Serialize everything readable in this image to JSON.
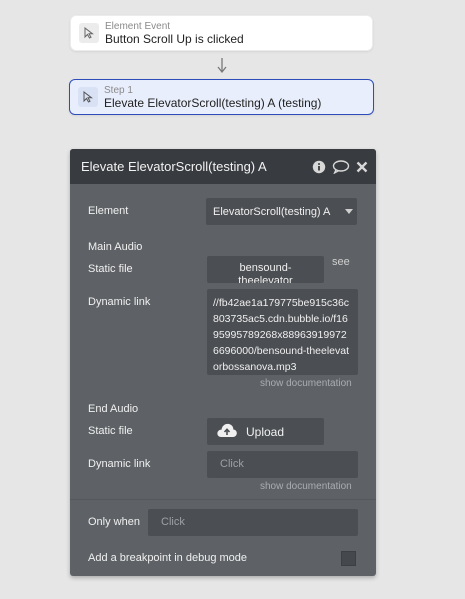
{
  "event_card": {
    "kind": "Element Event",
    "title": "Button Scroll Up is clicked",
    "icon": "pointer-icon"
  },
  "step_card": {
    "kind": "Step 1",
    "title": "Elevate ElevatorScroll(testing) A (testing)",
    "icon": "pointer-icon"
  },
  "panel": {
    "title": "Elevate ElevatorScroll(testing) A",
    "icons": [
      "info-icon",
      "comment-icon",
      "close-icon"
    ],
    "element_label": "Element",
    "element_value": "ElevatorScroll(testing) A",
    "main_audio": {
      "heading": "Main Audio",
      "static_label": "Static file",
      "static_value": "bensound-",
      "static_value_cut": "theelevator",
      "see": "see",
      "dynamic_label": "Dynamic link",
      "dynamic_value": "//fb42ae1a179775be915c36c803735ac5.cdn.bubble.io/f1695995789268x889639199726696000/bensound-theelevatorbossanova.mp3",
      "show_doc": "show documentation"
    },
    "end_audio": {
      "heading": "End Audio",
      "static_label": "Static file",
      "upload_label": "Upload",
      "dynamic_label": "Dynamic link",
      "dynamic_placeholder": "Click",
      "show_doc": "show documentation"
    },
    "only_when_label": "Only when",
    "only_when_placeholder": "Click",
    "breakpoint_label": "Add a breakpoint in debug mode"
  },
  "colors": {
    "background": "#e6e6e6",
    "panel": "#5e6266",
    "panel_header": "#383b3f",
    "field": "#4b4e52",
    "step_highlight_border": "#2e4dbb",
    "step_highlight_bg": "#e8eefb"
  }
}
